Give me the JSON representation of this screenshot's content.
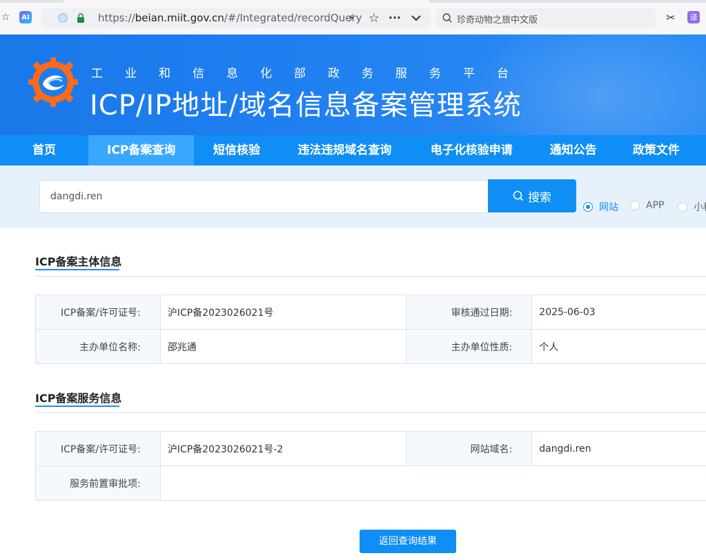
{
  "browser": {
    "url_prefix": "https://",
    "url_host": "beian.miit.gov.cn",
    "url_path": "/#/Integrated/recordQuery",
    "search_text": "珍奇动物之旅中文版",
    "ai_badge": "AI",
    "translate_badge": "译"
  },
  "header": {
    "ministry": "工业和信息化部政务服务平台",
    "system_title": "ICP/IP地址/域名信息备案管理系统"
  },
  "nav": {
    "items": [
      {
        "label": "首页",
        "active": false
      },
      {
        "label": "ICP备案查询",
        "active": true
      },
      {
        "label": "短信核验",
        "active": false
      },
      {
        "label": "违法违规域名查询",
        "active": false
      },
      {
        "label": "电子化核验申请",
        "active": false
      },
      {
        "label": "通知公告",
        "active": false
      },
      {
        "label": "政策文件",
        "active": false
      }
    ]
  },
  "search": {
    "query": "dangdi.ren",
    "button_label": "搜索",
    "options": [
      {
        "label": "网站",
        "checked": true
      },
      {
        "label": "APP",
        "checked": false
      },
      {
        "label": "小程序",
        "checked": false
      }
    ]
  },
  "entity_section": {
    "title": "ICP备案主体信息",
    "rows": [
      {
        "label1": "ICP备案/许可证号:",
        "value1": "沪ICP备2023026021号",
        "label2": "审核通过日期:",
        "value2": "2025-06-03"
      },
      {
        "label1": "主办单位名称:",
        "value1": "邵兆通",
        "label2": "主办单位性质:",
        "value2": "个人"
      }
    ]
  },
  "service_section": {
    "title": "ICP备案服务信息",
    "license_label": "ICP备案/许可证号:",
    "license_value": "沪ICP备2023026021号-2",
    "domain_label": "网站域名:",
    "domain_value": "dangdi.ren",
    "approval_label": "服务前置审批项:",
    "approval_value": ""
  },
  "back_button": "返回查询结果",
  "colors": {
    "primary": "#0f8ef5",
    "nav_active": "#3aa7ff",
    "banner": "#1a78e8"
  }
}
